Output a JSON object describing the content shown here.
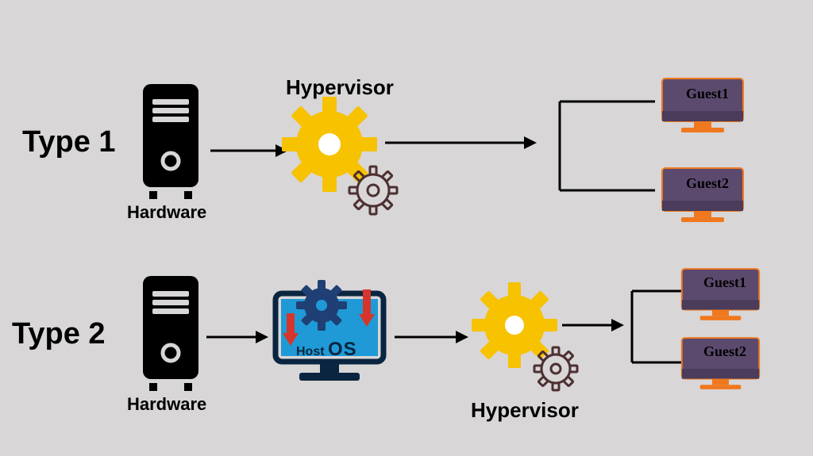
{
  "diagram": {
    "row1": {
      "type_label": "Type 1",
      "hardware_label": "Hardware",
      "hypervisor_label": "Hypervisor",
      "guest1": "Guest1",
      "guest2": "Guest2"
    },
    "row2": {
      "type_label": "Type 2",
      "hardware_label": "Hardware",
      "host_os_label_1": "Host",
      "host_os_label_2": "OS",
      "hypervisor_label": "Hypervisor",
      "guest1": "Guest1",
      "guest2": "Guest2"
    },
    "colors": {
      "gear_main": "#f7c200",
      "gear_small_stroke": "#4d3030",
      "server": "#000000",
      "monitor_screen": "#1f9ad6",
      "monitor_gear": "#1f3f75",
      "guest_body": "#5b4a6e",
      "guest_edge": "#f0781e"
    }
  }
}
